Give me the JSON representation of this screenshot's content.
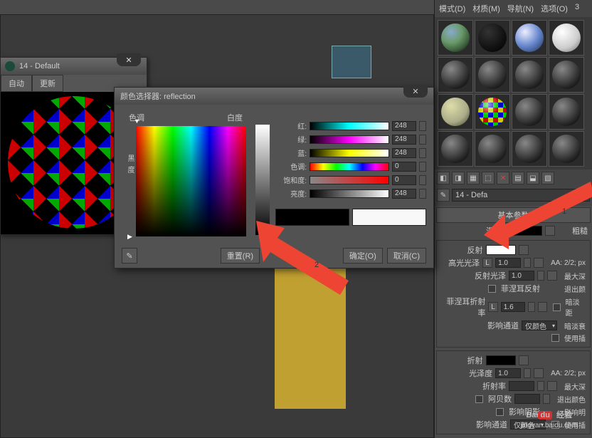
{
  "preview_window": {
    "title": "14 - Default",
    "tab_auto": "自动",
    "tab_update": "更新"
  },
  "rpanel": {
    "menu": {
      "mode": "模式(D)",
      "material": "材质(M)",
      "nav": "导航(N)",
      "options": "选项(O)",
      "more": "3"
    },
    "mat_name": "14 - Defa",
    "sec_basic": "基本参数",
    "diffuse_lbl": "漫反射",
    "rough_lbl": "粗糙",
    "reflect_hdr": "反射",
    "hilight_lbl": "高光光泽",
    "hilight_val": "1.0",
    "reflglos_lbl": "反射光泽",
    "reflglos_val": "1.0",
    "fresnel_lbl": "菲涅耳反射",
    "fresnel_ior_lbl": "菲涅耳折射率",
    "fresnel_ior_val": "1.6",
    "affect_lbl": "影响通道",
    "affect_val": "仅颜色",
    "aa_reflect": "AA: 2/2; px",
    "max_depth": "最大深",
    "exit_color": "退出颜",
    "dim_dist": "暗淡距",
    "dim_fall": "暗淡衰",
    "use_interp": "使用插",
    "refract_hdr": "折射",
    "glossiness_lbl": "光泽度",
    "glossiness_val": "1.0",
    "ior_lbl": "折射率",
    "abbe_lbl": "阿贝数",
    "affect_shadows": "影响阴影",
    "aa_refract": "AA: 2/2; px",
    "max_depth2": "最大深",
    "exit_color2": "退出颜色",
    "affect_alpha": "影响明",
    "use_interp2": "使用插",
    "affect_channel2": "影响通道",
    "affect_val2": "仅颜色"
  },
  "picker": {
    "title": "颜色选择器: reflection",
    "hue_lbl": "色调",
    "whiteness_lbl": "白度",
    "blackness_lbl": "黑度",
    "red": "红:",
    "green": "绿:",
    "blue": "蓝:",
    "hue": "色调:",
    "sat": "饱和度:",
    "val": "亮度:",
    "rv": "248",
    "gv": "248",
    "bv": "248",
    "hv": "0",
    "sv": "0",
    "vv": "248",
    "reset": "重置(R)",
    "ok": "确定(O)",
    "cancel": "取消(C)"
  },
  "arrows": {
    "label1": "1",
    "label2": "2"
  },
  "watermark": {
    "brand_a": "Bai",
    "brand_b": "du",
    "brand_c": "经验",
    "url": "jingyan.baidu.com"
  }
}
